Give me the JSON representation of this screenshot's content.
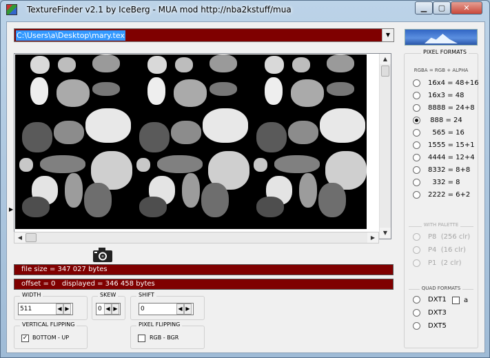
{
  "window": {
    "title": "TextureFinder v2.1 by IceBerg - MUA mod http://nba2kstuff/mua",
    "minimize_label": "▁",
    "maximize_label": "▢",
    "close_label": "✕"
  },
  "file": {
    "path": "C:\\Users\\a\\Desktop\\mary.tex"
  },
  "status": {
    "file_size": "file size = 347 027 bytes",
    "offset": "offset = 0   displayed = 346 458 bytes"
  },
  "width": {
    "label": "WIDTH",
    "value": "511"
  },
  "skew": {
    "label": "SKEW",
    "value": "0"
  },
  "shift": {
    "label": "SHIFT",
    "value": "0"
  },
  "vertical_flipping": {
    "label": "VERTICAL FLIPPING",
    "option": "BOTTOM - UP",
    "checked": true
  },
  "pixel_flipping": {
    "label": "PIXEL FLIPPING",
    "option": "RGB  -  BGR",
    "checked": false
  },
  "pixel_formats": {
    "title": "PIXEL FORMATS",
    "subtitle": "RGBA = RGB + ALPHA",
    "selected": "888 = 24",
    "options": [
      "16x4 = 48+16",
      "16x3 = 48",
      "8888 = 24+8",
      " 888 = 24",
      "  565 = 16",
      "1555 = 15+1",
      "4444 = 12+4",
      "8332 = 8+8",
      "  332 = 8",
      "2222 = 6+2"
    ]
  },
  "palette": {
    "title": "WITH PALETTE",
    "options": [
      "P8  (256 clr)",
      "P4  (16 clr)",
      "P1  (2 clr)"
    ]
  },
  "quad_formats": {
    "title": "QUAD FORMATS",
    "options": [
      "DXT1",
      "DXT3",
      "DXT5"
    ],
    "alpha_label": "a"
  },
  "colors": {
    "status_bg": "#7f0000",
    "selection": "#3399ff"
  },
  "icons": {
    "camera": "camera-icon",
    "scroll_up": "scroll-up-icon",
    "scroll_down": "scroll-down-icon",
    "scroll_left": "scroll-left-icon",
    "scroll_right": "scroll-right-icon"
  }
}
